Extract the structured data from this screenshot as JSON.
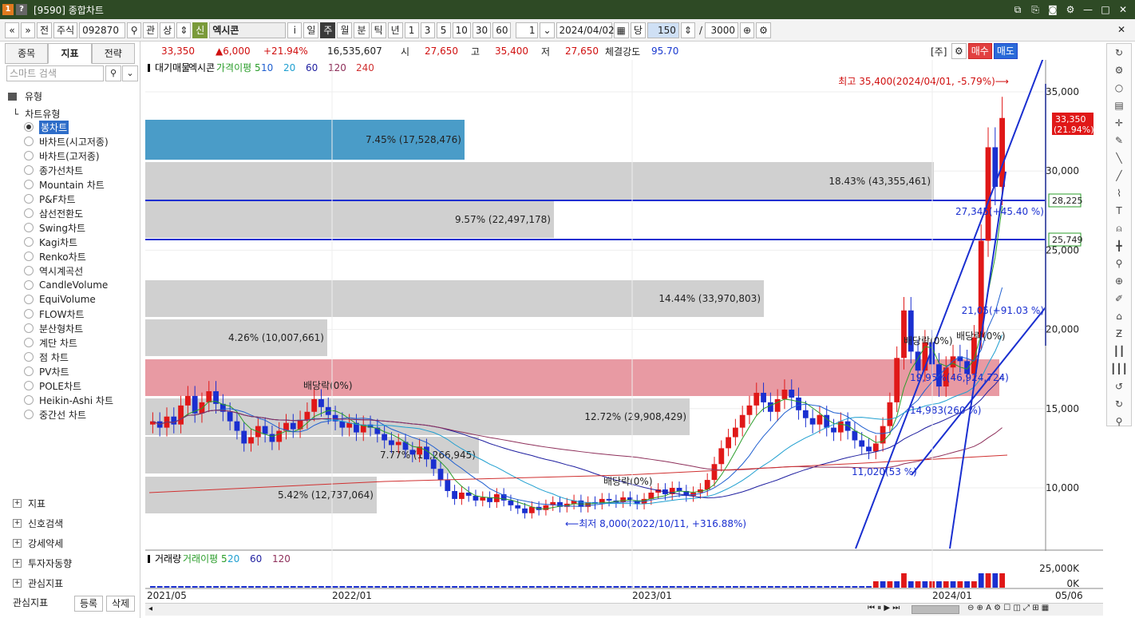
{
  "window": {
    "icon1": "1",
    "icon2": "?",
    "title": "[9590] 종합차트"
  },
  "toolbar": {
    "nav_prev": "«",
    "nav_down": "»",
    "full": "전",
    "market": "주식",
    "code": "092870",
    "search": "⚲",
    "watch": "관",
    "up": "상",
    "credit": "신",
    "name": "엑시콘",
    "info": "i",
    "periods": [
      "일",
      "주",
      "월",
      "분",
      "틱",
      "년"
    ],
    "active_period": "주",
    "minutes": [
      "1",
      "3",
      "5",
      "10",
      "30",
      "60"
    ],
    "interval": "1",
    "date": "2024/04/02",
    "unit": "당",
    "count": "150",
    "total": "3000"
  },
  "left_panel": {
    "tabs": [
      "종목",
      "지표",
      "전략"
    ],
    "active_tab": "지표",
    "search_placeholder": "스마트 검색",
    "type_header": "유형",
    "chart_type_label": "차트유형",
    "chart_types": [
      "봉차트",
      "바차트(시고저종)",
      "바차트(고저종)",
      "종가선차트",
      "Mountain 차트",
      "P&F차트",
      "삼선전환도",
      "Swing차트",
      "Kagi차트",
      "Renko차트",
      "역시계곡선",
      "CandleVolume",
      "EquiVolume",
      "FLOW차트",
      "분산형차트",
      "계단 차트",
      "점 차트",
      "PV차트",
      "POLE차트",
      "Heikin-Ashi 차트",
      "중간선 차트"
    ],
    "selected_type": "봉차트",
    "bottom_sections": [
      "지표",
      "신호검색",
      "강세약세",
      "투자자동향",
      "관심지표"
    ],
    "fav_label": "관심지표",
    "register": "등록",
    "delete": "삭제"
  },
  "quote": {
    "price": "33,350",
    "change": "▲6,000",
    "change_pct": "+21.94%",
    "volume": "16,535,607",
    "open_label": "시",
    "open": "27,650",
    "high_label": "고",
    "high": "35,400",
    "low_label": "저",
    "low": "27,650",
    "strength_label": "체결강도",
    "strength": "95.70",
    "stock_tag": "[주]",
    "buy": "매수",
    "sell": "매도"
  },
  "legend": {
    "items": [
      "대기매물",
      "엑시콘",
      "가격이평 5",
      "10",
      "20",
      "60",
      "120",
      "240"
    ],
    "colors": [
      "#000000",
      "#000000",
      "#2a9d2a",
      "#1f5fd0",
      "#1f9fd0",
      "#1f1fa0",
      "#8e2f5a",
      "#d03030"
    ]
  },
  "vol_legend": {
    "items": [
      "거래량",
      "거래이평 5",
      "20",
      "60",
      "120"
    ],
    "colors": [
      "#000000",
      "#2a9d2a",
      "#1f9fd0",
      "#1f1fa0",
      "#8e2f5a"
    ]
  },
  "annotations": {
    "high": "최고 35,400(2024/04/01, -5.79%)⟶",
    "low": "⟵최저 8,000(2022/10/11, +316.88%)",
    "div1": "배당락(0%)",
    "div2": "배당락(0%)",
    "div3": "배당락(0%)",
    "div4": "배당락(0%)",
    "cur_price": "33,350",
    "cur_pct": "(21.94%)",
    "line1": "28,225",
    "line2": "25,749",
    "fib1": "27,345(+45.40 %)",
    "fib2": "21,05(+91.03 %)",
    "fib3": "19,95%(46,924,724)",
    "fib4": "14,983(260 %)",
    "fib5": "11,020(53 %)"
  },
  "volume_profile": [
    {
      "label": "7.45% (17,528,476)",
      "color": "#4a9cc8"
    },
    {
      "label": "18.43% (43,355,461)",
      "color": "#d0d0d0"
    },
    {
      "label": "9.57% (22,497,178)",
      "color": "#d0d0d0"
    },
    {
      "label": "14.44% (33,970,803)",
      "color": "#d0d0d0"
    },
    {
      "label": "4.26% (10,007,661)",
      "color": "#d0d0d0"
    },
    {
      "label": "19.95%",
      "color": "#e89aa3"
    },
    {
      "label": "12.72% (29,908,429)",
      "color": "#d0d0d0"
    },
    {
      "label": "7.77% (18,266,945)",
      "color": "#d0d0d0"
    },
    {
      "label": "5.42% (12,737,064)",
      "color": "#d0d0d0"
    }
  ],
  "yaxis": [
    "35,000",
    "30,000",
    "25,000",
    "20,000",
    "15,000",
    "10,000"
  ],
  "vol_axis": [
    "25,000K",
    "0K"
  ],
  "xaxis": [
    "2021/05",
    "2022/01",
    "2023/01",
    "2024/01",
    "05/06"
  ]
}
